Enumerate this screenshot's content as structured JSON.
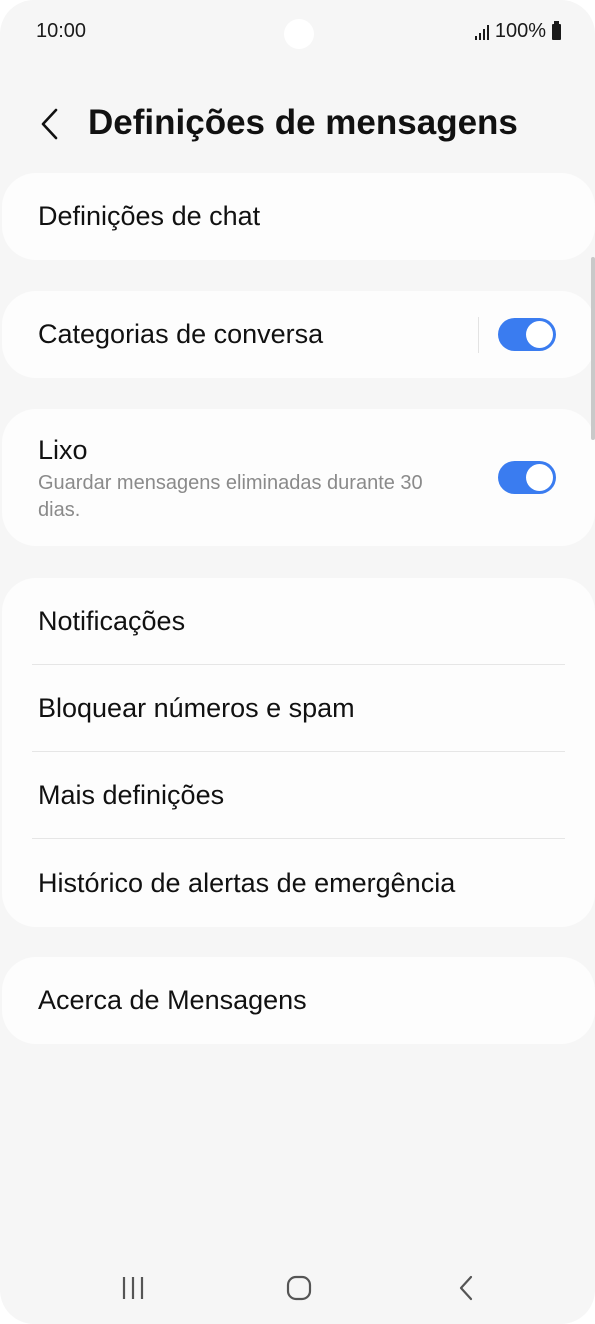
{
  "status_bar": {
    "time": "10:00",
    "battery": "100%"
  },
  "header": {
    "title": "Definições de mensagens"
  },
  "sections": {
    "chat": {
      "label": "Definições de chat"
    },
    "categories": {
      "label": "Categorias de conversa",
      "enabled": true
    },
    "trash": {
      "label": "Lixo",
      "subtext": "Guardar mensagens eliminadas durante 30 dias.",
      "enabled": true
    },
    "group": [
      {
        "label": "Notificações"
      },
      {
        "label": "Bloquear números e spam"
      },
      {
        "label": "Mais definições"
      },
      {
        "label": "Histórico de alertas de emergência"
      }
    ],
    "about": {
      "label": "Acerca de Mensagens"
    }
  },
  "colors": {
    "accent": "#3a7cf0",
    "background": "#f6f6f6",
    "card": "#fdfdfd"
  },
  "icons": [
    "back-arrow-icon",
    "signal-icon",
    "battery-icon",
    "recents-icon",
    "home-icon",
    "nav-back-icon"
  ]
}
